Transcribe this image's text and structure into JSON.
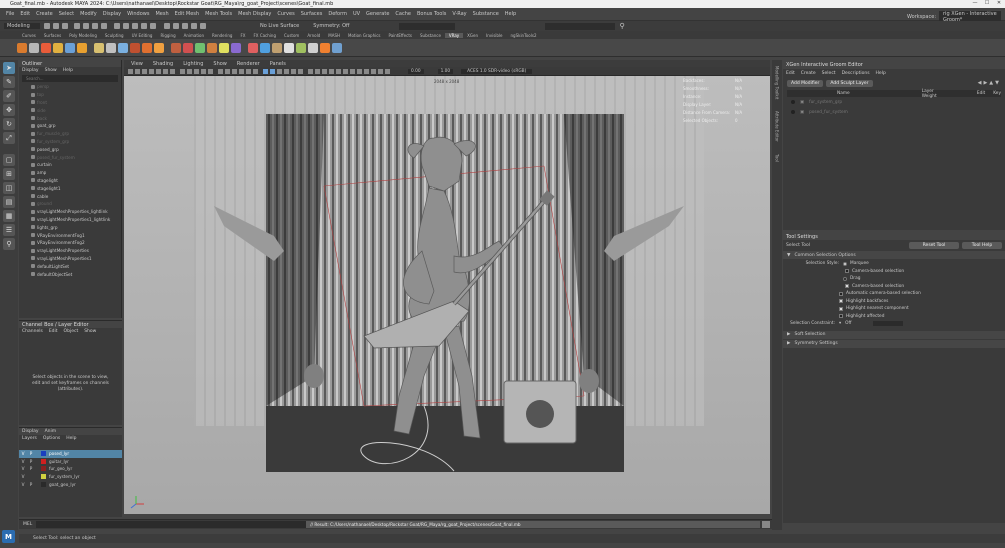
{
  "window": {
    "title": "Goat_final.mb - Autodesk MAYA 2024: C:\\Users\\nathanael\\Desktop\\Rockstar Goat\\RG_Maya\\rg_goat_Project\\scenes\\Goat_final.mb",
    "controls": [
      "—",
      "☐",
      "✕"
    ]
  },
  "menubar": {
    "items": [
      "File",
      "Edit",
      "Create",
      "Select",
      "Modify",
      "Display",
      "Windows",
      "Mesh",
      "Edit Mesh",
      "Mesh Tools",
      "Mesh Display",
      "Curves",
      "Surfaces",
      "Deform",
      "UV",
      "Generate",
      "Cache",
      "Bonus Tools",
      "V-Ray",
      "Substance",
      "Help"
    ],
    "workspace_label": "Workspace:",
    "workspace_value": "rig XGen - Interactive Groom*"
  },
  "statusline": {
    "mode": "Modeling",
    "live_surface": "No Live Surface",
    "symmetry": "Symmetry: Off"
  },
  "shelf": {
    "tabs": [
      "Curves",
      "Surfaces",
      "Poly Modeling",
      "Sculpting",
      "UV Editing",
      "Rigging",
      "Animation",
      "Rendering",
      "FX",
      "FX Caching",
      "Custom",
      "Arnold",
      "MASH",
      "Motion Graphics",
      "PaintEffects",
      "Substance",
      "VRay",
      "XGen",
      "Invisible",
      "ngSkinTools2"
    ],
    "active_tab": "VRay",
    "icon_colors": [
      "#d97b2e",
      "#b8b8b8",
      "#e85c3a",
      "#e0b040",
      "#6aa0d8",
      "#e8a030",
      "#d8c070",
      "#c0c0c0",
      "#7ab0e0",
      "#c05030",
      "#e07030",
      "#f0a040",
      "#c06040",
      "#d05050",
      "#70c070",
      "#d08040",
      "#e0e060",
      "#8a6ad0",
      "#e06060",
      "#50a0e0",
      "#c0a070",
      "#e0e0e0",
      "#a0c060",
      "#d0d0d0",
      "#f08030",
      "#70a0d0"
    ]
  },
  "outliner": {
    "title": "Outliner",
    "menus": [
      "Display",
      "Show",
      "Help"
    ],
    "search_placeholder": "Search...",
    "items": [
      {
        "label": "persp",
        "dim": true
      },
      {
        "label": "top",
        "dim": true
      },
      {
        "label": "front",
        "dim": true
      },
      {
        "label": "side",
        "dim": true
      },
      {
        "label": "back",
        "dim": true
      },
      {
        "label": "goat_grp",
        "dim": false
      },
      {
        "label": "fur_muscle_grp",
        "dim": true
      },
      {
        "label": "fur_system_grp",
        "dim": true
      },
      {
        "label": "posed_grp",
        "dim": false
      },
      {
        "label": "posed_fur_system",
        "dim": true
      },
      {
        "label": "curtain",
        "dim": false
      },
      {
        "label": "amp",
        "dim": false
      },
      {
        "label": "stagelight",
        "dim": false
      },
      {
        "label": "stagelight1",
        "dim": false
      },
      {
        "label": "cable",
        "dim": false
      },
      {
        "label": "ground",
        "dim": true
      },
      {
        "label": "vrayLightMeshProperties_lightlink",
        "dim": false
      },
      {
        "label": "vrayLightMeshProperties1_lightlink",
        "dim": false
      },
      {
        "label": "lights_grp",
        "dim": false
      },
      {
        "label": "VRayEnvironmentFog1",
        "dim": false
      },
      {
        "label": "VRayEnvironmentFog2",
        "dim": false
      },
      {
        "label": "vrayLightMeshProperties",
        "dim": false
      },
      {
        "label": "vrayLightMeshProperties1",
        "dim": false
      },
      {
        "label": "defaultLightSet",
        "dim": false
      },
      {
        "label": "defaultObjectSet",
        "dim": false
      }
    ]
  },
  "channelbox": {
    "title": "Channel Box / Layer Editor",
    "menus": [
      "Channels",
      "Edit",
      "Object",
      "Show"
    ],
    "message": "Select objects in the scene to view, edit and set keyframes on channels (attributes)."
  },
  "layers": {
    "tabs": [
      "Display",
      "Anim"
    ],
    "menus": [
      "Layers",
      "Options",
      "Help"
    ],
    "rows": [
      {
        "v": "V",
        "p": "P",
        "color": "#1a3fbf",
        "name": "posed_lyr",
        "selected": true
      },
      {
        "v": "V",
        "p": "P",
        "color": "#d02020",
        "name": "guitar_lyr",
        "selected": false
      },
      {
        "v": "V",
        "p": "P",
        "color": "#8a2020",
        "name": "fur_geo_lyr",
        "selected": false
      },
      {
        "v": "V",
        "p": "",
        "color": "#d0d040",
        "name": "fur_system_lyr",
        "selected": false
      },
      {
        "v": "V",
        "p": "P",
        "color": "#2a2a2a",
        "name": "goat_geo_lyr",
        "selected": false
      }
    ]
  },
  "viewport": {
    "menus": [
      "View",
      "Shading",
      "Lighting",
      "Show",
      "Renderer",
      "Panels"
    ],
    "exposure": "0.00",
    "gamma": "1.00",
    "colorspace": "ACES 1.0 SDR-video (sRGB)",
    "resolution_gate": "2048 x 2048",
    "hud": [
      {
        "k": "Backfaces:",
        "v": "N/A"
      },
      {
        "k": "Smoothness:",
        "v": "N/A"
      },
      {
        "k": "Instance:",
        "v": "N/A"
      },
      {
        "k": "Display Layer:",
        "v": "N/A"
      },
      {
        "k": "Distance From Camera:",
        "v": "N/A"
      },
      {
        "k": "Selected Objects:",
        "v": "0"
      }
    ]
  },
  "rightstrip": {
    "tabs": [
      "Modelling Toolkit",
      "Attribute Editor",
      "Tool"
    ]
  },
  "xgen": {
    "title": "XGen Interactive Groom Editor",
    "menus": [
      "Edit",
      "Create",
      "Select",
      "Descriptions",
      "Help"
    ],
    "add_modifier": "Add Modifier",
    "add_sculpt": "Add Sculpt Layer",
    "columns": [
      "Name",
      "Layer Weight",
      "Edit",
      "Key"
    ],
    "rows": [
      "fur_system_grp",
      "posed_fur_system"
    ]
  },
  "toolsettings": {
    "title": "Tool Settings",
    "tool_name": "Select Tool",
    "reset": "Reset Tool",
    "help": "Tool Help",
    "section_common": "Common Selection Options",
    "selection_style_label": "Selection Style:",
    "marquee": "Marquee",
    "camera_based": "Camera-based selection",
    "drag": "Drag",
    "camera_based2": "Camera-based selection",
    "auto_camera": "Automatic camera-based selection",
    "highlight_backfaces": "Highlight backfaces",
    "highlight_nearest": "Highlight nearest component",
    "highlight_affected": "Highlight affected",
    "constraint_label": "Selection Constraint:",
    "constraint_value": "Off",
    "soft_selection": "Soft Selection",
    "symmetry_settings": "Symmetry Settings"
  },
  "cmdline": {
    "label": "MEL",
    "result": "// Result: C:/Users/nathanael/Desktop/Rockstar Goat/RG_Maya/rg_goat_Project/scenes/Goat_final.mb"
  },
  "helpline": {
    "text": "Select Tool: select an object"
  },
  "logo": "M"
}
